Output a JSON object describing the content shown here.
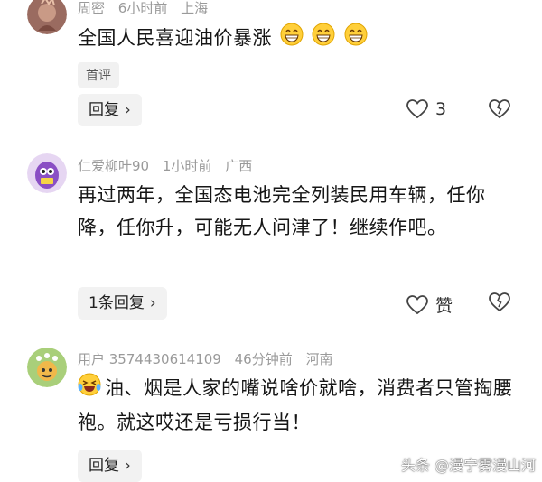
{
  "comments": [
    {
      "username": "周密",
      "time": "6小时前",
      "location": "上海",
      "text": "全国人民喜迎油价暴涨",
      "tag": "首评",
      "reply_label": "回复",
      "likes": "3"
    },
    {
      "username": "仁爱柳叶90",
      "time": "1小时前",
      "location": "广西",
      "text": "再过两年，全国态电池完全列装民用车辆，任你降，任你升，可能无人问津了！继续作吧。",
      "reply_label": "1条回复",
      "likes": "赞"
    },
    {
      "username": "用户 3574430614109",
      "time": "46分钟前",
      "location": "河南",
      "text": "油、烟是人家的嘴说啥价就啥，消费者只管掏腰袍。就这哎还是亏损行当！",
      "reply_label": "回复"
    }
  ],
  "watermark": "头条 @漫宁雾漫山河",
  "icons": {
    "like": "heart-outline-icon",
    "dislike": "broken-heart-icon",
    "reply_chevron": "chevron-right-icon"
  }
}
